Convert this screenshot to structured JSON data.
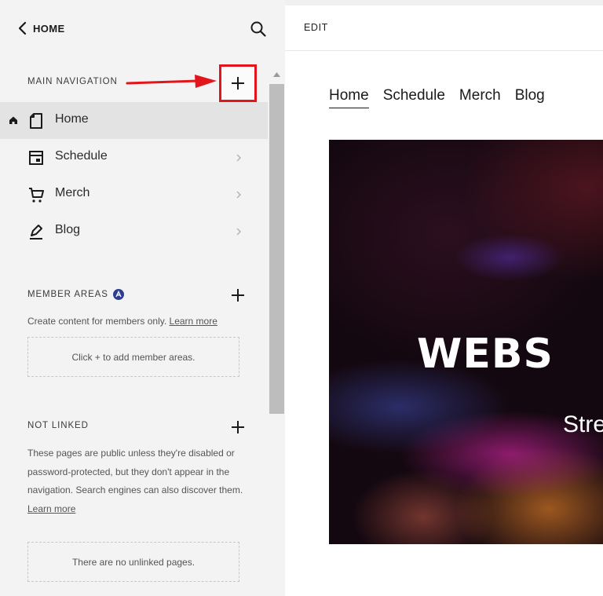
{
  "sidebar": {
    "back_label": "HOME",
    "main_navigation": {
      "label": "MAIN NAVIGATION",
      "items": [
        {
          "label": "Home",
          "icon": "page-icon",
          "active": true,
          "is_homepage": true
        },
        {
          "label": "Schedule",
          "icon": "calendar-icon",
          "active": false
        },
        {
          "label": "Merch",
          "icon": "cart-icon",
          "active": false
        },
        {
          "label": "Blog",
          "icon": "blog-pen-icon",
          "active": false
        }
      ]
    },
    "member_areas": {
      "label": "MEMBER AREAS",
      "description": "Create content for members only.",
      "learn_more": "Learn more",
      "empty_text": "Click + to add member areas."
    },
    "not_linked": {
      "label": "NOT LINKED",
      "description": "These pages are public unless they're disabled or password-protected, but they don't appear in the navigation. Search engines can also discover them.",
      "learn_more": "Learn more",
      "empty_text": "There are no unlinked pages."
    }
  },
  "editor": {
    "edit_label": "EDIT",
    "site_nav": [
      "Home",
      "Schedule",
      "Merch",
      "Blog"
    ],
    "hero": {
      "title": "WEBS",
      "subtitle": "Stre"
    }
  },
  "colors": {
    "annotation_red": "#e1151b",
    "member_badge_blue": "#2c3e8f",
    "sidebar_bg": "#f3f3f3",
    "active_row_bg": "#e3e3e3"
  }
}
